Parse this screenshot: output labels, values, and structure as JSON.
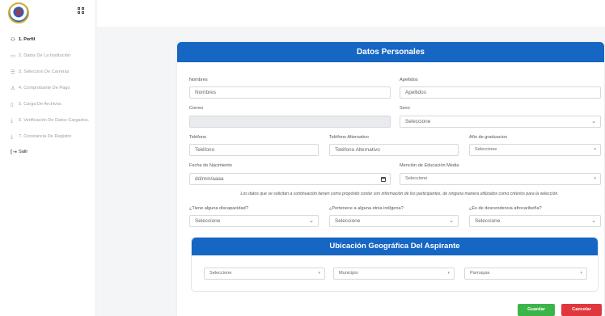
{
  "sidebar": {
    "items": [
      {
        "label": "1. Perfil",
        "icon": "user-icon"
      },
      {
        "label": "2. Datos De La Institución",
        "icon": "institution-icon"
      },
      {
        "label": "3. Seleccion De Carreras",
        "icon": "list-icon"
      },
      {
        "label": "4. Comprobante De Pago",
        "icon": "payment-icon"
      },
      {
        "label": "5. Carga De Archivos",
        "icon": "file-icon"
      },
      {
        "label": "6. Verificación De Datos Cargados.",
        "icon": "upload-check-icon"
      },
      {
        "label": "7. Constancia De Registro",
        "icon": "certificate-icon"
      },
      {
        "label": "Salir",
        "icon": "logout-icon"
      }
    ]
  },
  "form": {
    "title": "Datos Personales",
    "nombres": {
      "label": "Nombres",
      "placeholder": "Nombres"
    },
    "apellidos": {
      "label": "Apellidos",
      "placeholder": "Apellidos"
    },
    "correo": {
      "label": "Correo",
      "value": ""
    },
    "sexo": {
      "label": "Sexo",
      "value": "Seleccione"
    },
    "telefono": {
      "label": "Teléfono",
      "placeholder": "Teléfono"
    },
    "telefono_alt": {
      "label": "Teléfono Alternativo",
      "placeholder": "Teléfono Alternativo"
    },
    "anio_grad": {
      "label": "Año de graduacion",
      "value": "Seleccione"
    },
    "fecha_nac": {
      "label": "Fecha de Nacimiento",
      "value": "dd/mm/aaaa"
    },
    "mencion": {
      "label": "Mención de Educación Media",
      "value": "Seleccione"
    },
    "note": "Los datos que se solicitan a continuación tienen como propósito contar con información de los participantes, de ninguna manera utilizados como criterios para la selección.",
    "discapacidad": {
      "label": "¿Tiene alguna discapacidad?",
      "value": "Seleccione"
    },
    "etnia": {
      "label": "¿Pertenece a alguna etnia indígena?",
      "value": "Seleccione"
    },
    "afro": {
      "label": "¿Es de descendencia afrocaribeña?",
      "value": "Seleccione"
    }
  },
  "geo": {
    "title": "Ubicación Geográfica Del Aspirante",
    "estado": "Seleccione",
    "municipio": "Municipio",
    "parroquia": "Parroquia"
  },
  "actions": {
    "save": "Guardar",
    "cancel": "Cancelar"
  },
  "colors": {
    "primary": "#1666c3",
    "save": "#3bb54a",
    "cancel": "#e0373e"
  }
}
